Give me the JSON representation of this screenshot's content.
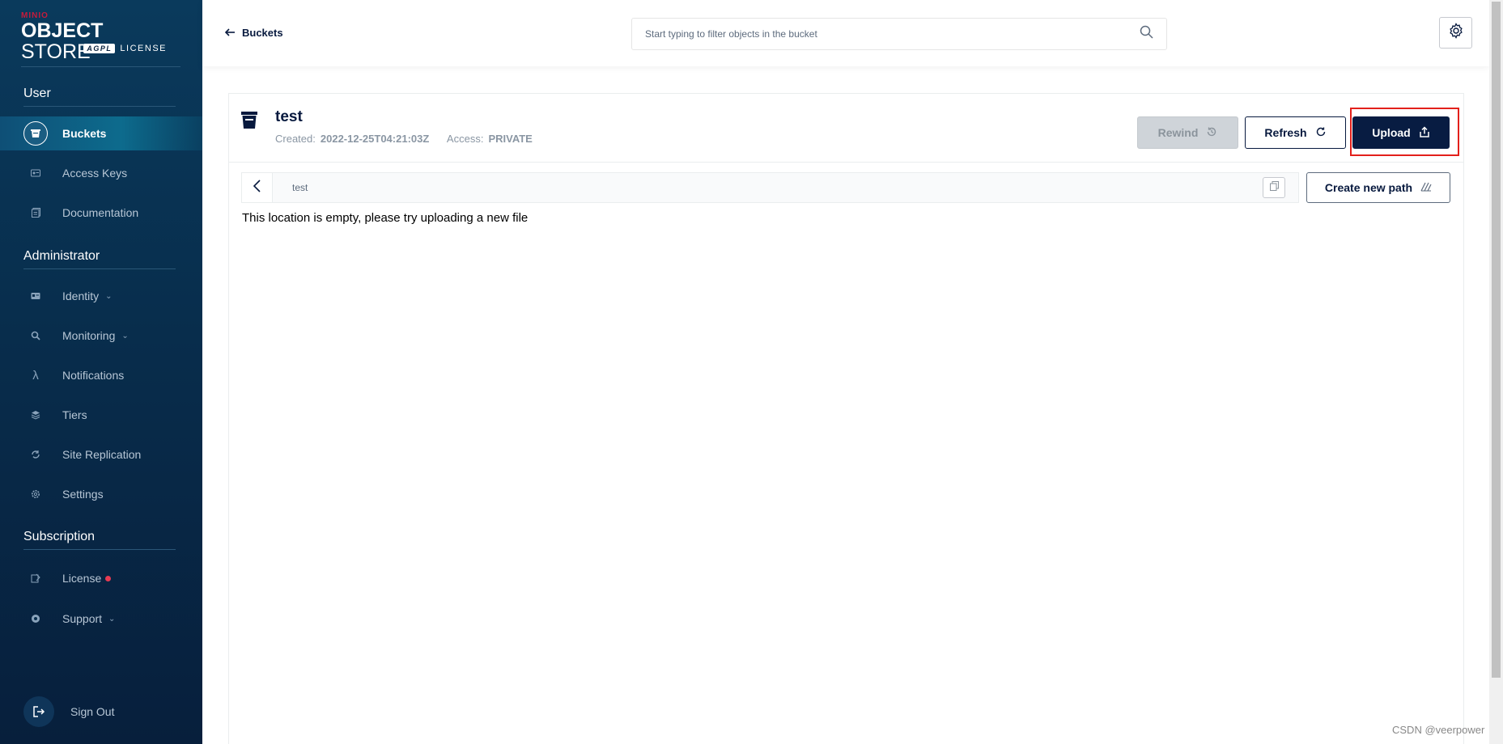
{
  "sidebar": {
    "logo": {
      "brand": "MINIO",
      "title_bold": "OBJECT",
      "title_light": "STORE",
      "badge": "AGPL",
      "license_text": "LICENSE"
    },
    "sections": {
      "user": "User",
      "administrator": "Administrator",
      "subscription": "Subscription"
    },
    "items": {
      "buckets": "Buckets",
      "access_keys": "Access Keys",
      "documentation": "Documentation",
      "identity": "Identity",
      "monitoring": "Monitoring",
      "notifications": "Notifications",
      "tiers": "Tiers",
      "site_replication": "Site Replication",
      "settings": "Settings",
      "license": "License",
      "support": "Support"
    },
    "sign_out": "Sign Out"
  },
  "header": {
    "back_label": "Buckets",
    "search_placeholder": "Start typing to filter objects in the bucket"
  },
  "bucket": {
    "name": "test",
    "created_label": "Created:",
    "created_value": "2022-12-25T04:21:03Z",
    "access_label": "Access:",
    "access_value": "PRIVATE"
  },
  "actions": {
    "rewind": "Rewind",
    "refresh": "Refresh",
    "upload": "Upload",
    "create_path": "Create new path"
  },
  "browser": {
    "path": "test",
    "empty_message": "This location is empty, please try uploading a new file"
  },
  "watermark": "CSDN @veerpower",
  "colors": {
    "sidebar_bg": "#082d4c",
    "primary": "#081c42",
    "highlight": "#e3201b",
    "license_dot": "#e83b52"
  }
}
